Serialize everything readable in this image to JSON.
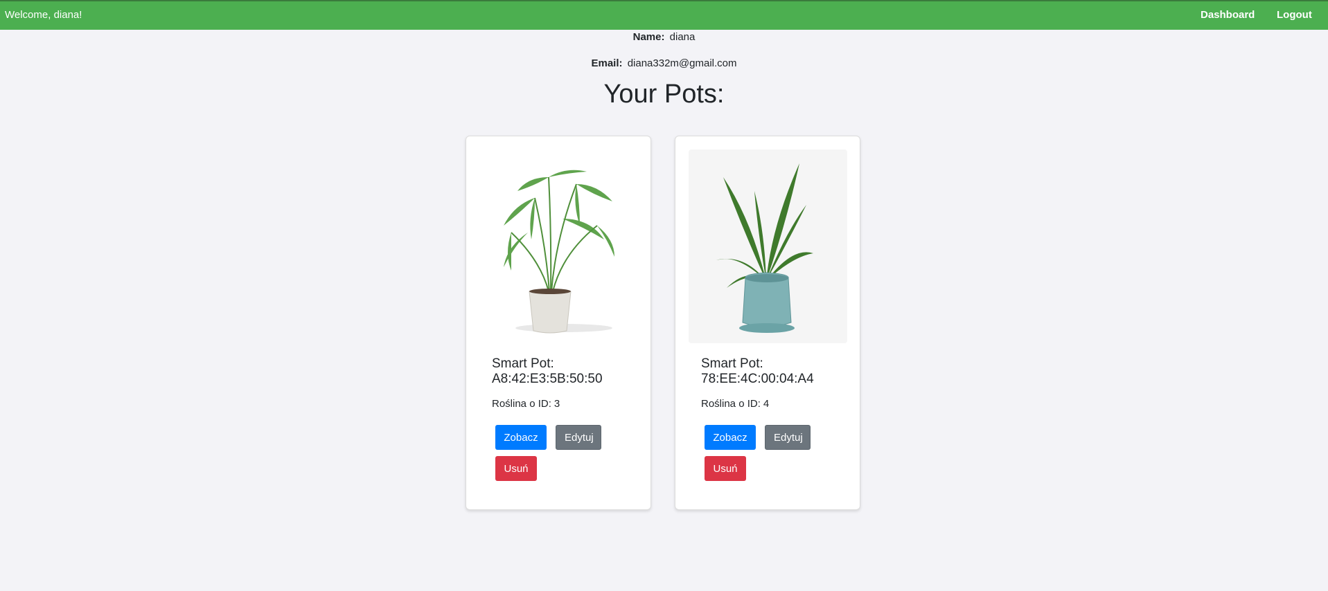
{
  "header": {
    "welcome": "Welcome, diana!",
    "nav": {
      "dashboard": "Dashboard",
      "logout": "Logout"
    },
    "bg_color": "#4caf50"
  },
  "profile": {
    "name_label": "Name:",
    "name_value": "diana",
    "email_label": "Email:",
    "email_value": "diana332m@gmail.com"
  },
  "pots_heading": "Your Pots:",
  "pots": [
    {
      "title": "Smart Pot:",
      "mac": "A8:42:E3:5B:50:50",
      "plant_label": "Roślina o ID:",
      "plant_id": "3",
      "image_icon": "palm-plant-white-pot",
      "buttons": {
        "view": "Zobacz",
        "edit": "Edytuj",
        "delete": "Usuń"
      }
    },
    {
      "title": "Smart Pot:",
      "mac": "78:EE:4C:00:04:A4",
      "plant_label": "Roślina o ID:",
      "plant_id": "4",
      "image_icon": "plant-teal-pot",
      "buttons": {
        "view": "Zobacz",
        "edit": "Edytuj",
        "delete": "Usuń"
      }
    }
  ],
  "colors": {
    "view": "#007bff",
    "edit": "#6c757d",
    "delete": "#dc3545",
    "page_bg": "#f3f3f7"
  }
}
